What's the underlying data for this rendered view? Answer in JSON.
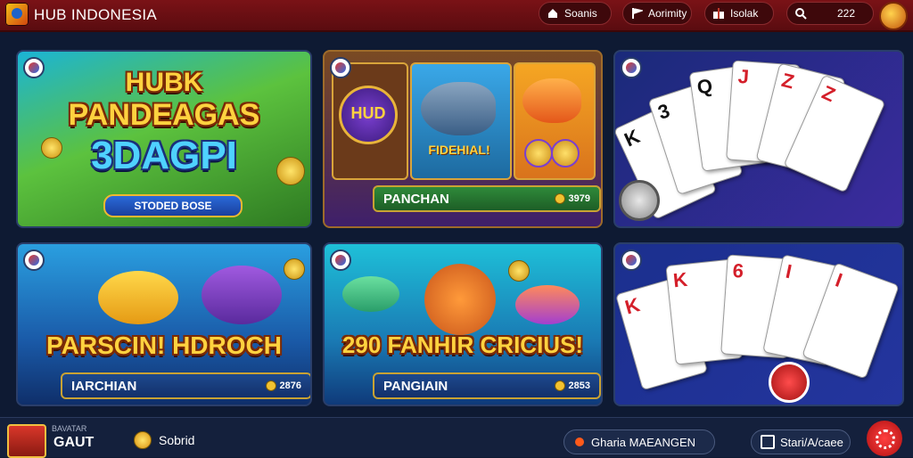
{
  "header": {
    "brand": "HUB INDONESIA",
    "pills": [
      {
        "label": "Soanis",
        "icon": "home-icon"
      },
      {
        "label": "Aorimity",
        "icon": "flag-icon"
      },
      {
        "label": "Isolak",
        "icon": "gift-icon"
      },
      {
        "label": "222",
        "icon": "search-icon"
      }
    ]
  },
  "games": [
    {
      "title_line1": "HUBK",
      "title_line2": "PANDEAGAS",
      "title_line3": "3DAGPI",
      "ribbon": "STODED BOSE"
    },
    {
      "emblem": "HUD",
      "fish_title": "FIDEHIAL!",
      "bar_label": "PANCHAN",
      "bar_value": "3979"
    },
    {
      "kind": "cards"
    },
    {
      "title": "PARSCIN! HDROCH",
      "bar_label": "IARCHIAN",
      "bar_value": "2876"
    },
    {
      "title": "290 FANHIR CRICIUS!",
      "bar_label": "PANGIAIN",
      "bar_value": "2853"
    },
    {
      "kind": "cards"
    }
  ],
  "card_ranks": {
    "game3": [
      "K",
      "3",
      "Q",
      "J",
      "Z",
      "Z"
    ],
    "game6": [
      "K",
      "K",
      "6",
      "I",
      "I"
    ]
  },
  "footer": {
    "user_sub": "BAVATAR",
    "user_name": "GAUT",
    "balance": "Sobrid",
    "button_left": "Gharia MAEANGEN",
    "button_right": "Stari/A/caee"
  },
  "colors": {
    "header_red": "#7a1216",
    "gold": "#ffd23f",
    "background": "#0e1a33"
  }
}
